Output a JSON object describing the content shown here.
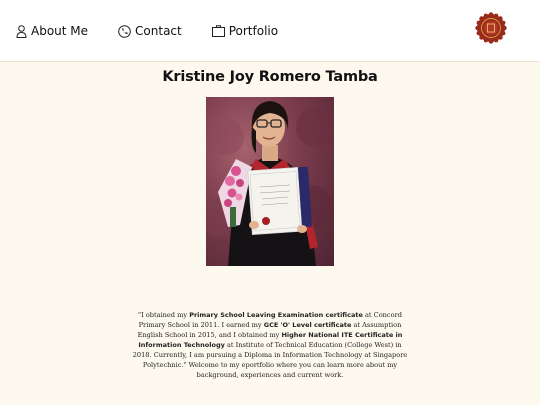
{
  "nav": {
    "about_label": "About Me",
    "contact_label": "Contact",
    "portfolio_label": "Portfolio"
  },
  "logo_icon": "seal-badge-icon",
  "page": {
    "title": "Kristine Joy Romero Tamba"
  },
  "photo": {
    "description_icon": "graduation-photo"
  },
  "bio": {
    "p1": "\"I obtained my ",
    "b1": "Primary School Leaving Examination certificate",
    "p2": " at Concord Primary School in 2011. I earned my ",
    "b2": "GCE 'O' Level certificate",
    "p3": " at Assumption English School in 2015, and I obtained my ",
    "b3": "Higher National ITE Certificate in Information Technology",
    "p4": " at Institute of Technical Education (College West) in 2018. Currently, I am pursuing a Diploma in Information Technology at Singapore Polytechnic.\" Welcome to my eportfolio where you can learn more about my background, experiences and current work."
  },
  "colors": {
    "background": "#fdf9ef",
    "header": "#ffffff",
    "seal": "#9a2a1a"
  }
}
